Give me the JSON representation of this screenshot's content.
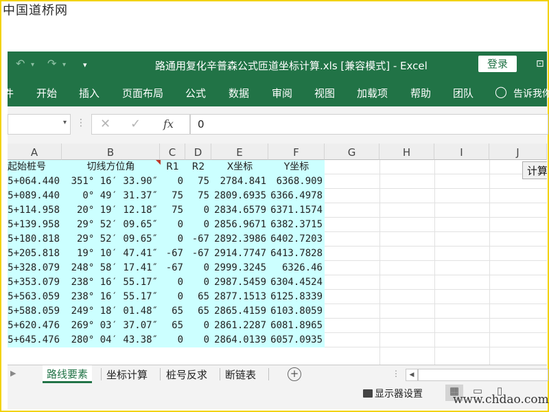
{
  "watermark_top": "中国道桥网",
  "watermark_bottom": "www.chdao.com",
  "titlebar": {
    "title": "路通用复化辛普森公式匝道坐标计算.xls [兼容模式] - Excel",
    "login_label": "登录",
    "undo_icon": "undo-icon",
    "redo_icon": "redo-icon"
  },
  "ribbon": {
    "tabs": [
      "开始",
      "插入",
      "页面布局",
      "公式",
      "数据",
      "审阅",
      "视图",
      "加载项",
      "帮助",
      "团队"
    ],
    "tell_me": "告诉我你",
    "file_cut": "件"
  },
  "formula_bar": {
    "fx": "fx",
    "value": "0"
  },
  "columns": [
    "A",
    "B",
    "C",
    "D",
    "E",
    "F",
    "G",
    "H",
    "I",
    "J"
  ],
  "table": {
    "headers": [
      "起始桩号",
      "切线方位角",
      "R1",
      "R2",
      "X坐标",
      "Y坐标"
    ],
    "rows": [
      [
        "5+064.440",
        "351° 16′ 33.90″",
        "0",
        "75",
        "2784.841",
        "6368.909"
      ],
      [
        "5+089.440",
        "0° 49′ 31.37″",
        "75",
        "75",
        "2809.6935",
        "6366.4978"
      ],
      [
        "5+114.958",
        "20° 19′ 12.18″",
        "75",
        "0",
        "2834.6579",
        "6371.1574"
      ],
      [
        "5+139.958",
        "29° 52′ 09.65″",
        "0",
        "0",
        "2856.9671",
        "6382.3715"
      ],
      [
        "5+180.818",
        "29° 52′ 09.65″",
        "0",
        "-67",
        "2892.3986",
        "6402.7203"
      ],
      [
        "5+205.818",
        "19° 10′ 47.41″",
        "-67",
        "-67",
        "2914.7747",
        "6413.7828"
      ],
      [
        "5+328.079",
        "248° 58′ 17.41″",
        "-67",
        "0",
        "2999.3245",
        "6326.46"
      ],
      [
        "5+353.079",
        "238° 16′ 55.17″",
        "0",
        "0",
        "2987.5459",
        "6304.4524"
      ],
      [
        "5+563.059",
        "238° 16′ 55.17″",
        "0",
        "65",
        "2877.1513",
        "6125.8339"
      ],
      [
        "5+588.059",
        "249° 18′ 01.48″",
        "65",
        "65",
        "2865.4159",
        "6103.8059"
      ],
      [
        "5+620.476",
        "269° 03′ 37.07″",
        "65",
        "0",
        "2861.2287",
        "6081.8965"
      ],
      [
        "5+645.476",
        "280° 04′ 43.38″",
        "0",
        "0",
        "2864.0139",
        "6057.0935"
      ]
    ]
  },
  "calc_button": "计算",
  "sheet_tabs": [
    "路线要素",
    "坐标计算",
    "桩号反求",
    "断链表"
  ],
  "active_sheet": 0,
  "status": {
    "display_settings": "显示器设置"
  }
}
